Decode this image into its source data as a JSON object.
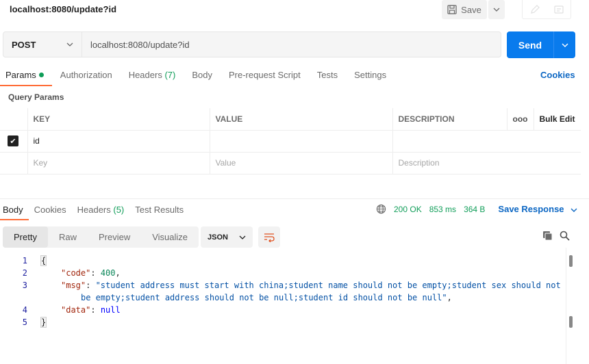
{
  "header": {
    "url_title": "localhost:8080/update?id",
    "save_label": "Save"
  },
  "request": {
    "method": "POST",
    "url": "localhost:8080/update?id",
    "send_label": "Send"
  },
  "req_tabs": [
    {
      "label": "Params"
    },
    {
      "label": "Authorization"
    },
    {
      "label": "Headers",
      "count": "(7)"
    },
    {
      "label": "Body"
    },
    {
      "label": "Pre-request Script"
    },
    {
      "label": "Tests"
    },
    {
      "label": "Settings"
    }
  ],
  "cookies_link": "Cookies",
  "query_params_label": "Query Params",
  "params_table": {
    "headers": {
      "key": "KEY",
      "value": "VALUE",
      "description": "DESCRIPTION",
      "more": "ooo",
      "bulk": "Bulk Edit"
    },
    "rows": [
      {
        "key": "id",
        "value": "",
        "description": "",
        "checked": true
      }
    ],
    "placeholders": {
      "key": "Key",
      "value": "Value",
      "description": "Description"
    }
  },
  "res_tabs": [
    {
      "label": "Body"
    },
    {
      "label": "Cookies"
    },
    {
      "label": "Headers",
      "count": "(5)"
    },
    {
      "label": "Test Results"
    }
  ],
  "status": {
    "code": "200 OK",
    "time": "853 ms",
    "size": "364 B",
    "save_response": "Save Response"
  },
  "view_options": [
    "Pretty",
    "Raw",
    "Preview",
    "Visualize"
  ],
  "format": "JSON",
  "response_body": {
    "line_numbers": [
      "1",
      "2",
      "3",
      "4",
      "5"
    ],
    "code_key": "\"code\"",
    "code_value": "400",
    "msg_key": "\"msg\"",
    "msg_value_line1": "\"student address must start with china;student name should not be empty;student sex should not",
    "msg_value_line2": "be empty;student address should not be null;student id should not be null\"",
    "data_key": "\"data\"",
    "data_value": "null"
  },
  "colors": {
    "accent": "#ff6c37",
    "send_blue": "#097bed",
    "link_blue": "#0b66c3",
    "success_green": "#0f9d58"
  }
}
